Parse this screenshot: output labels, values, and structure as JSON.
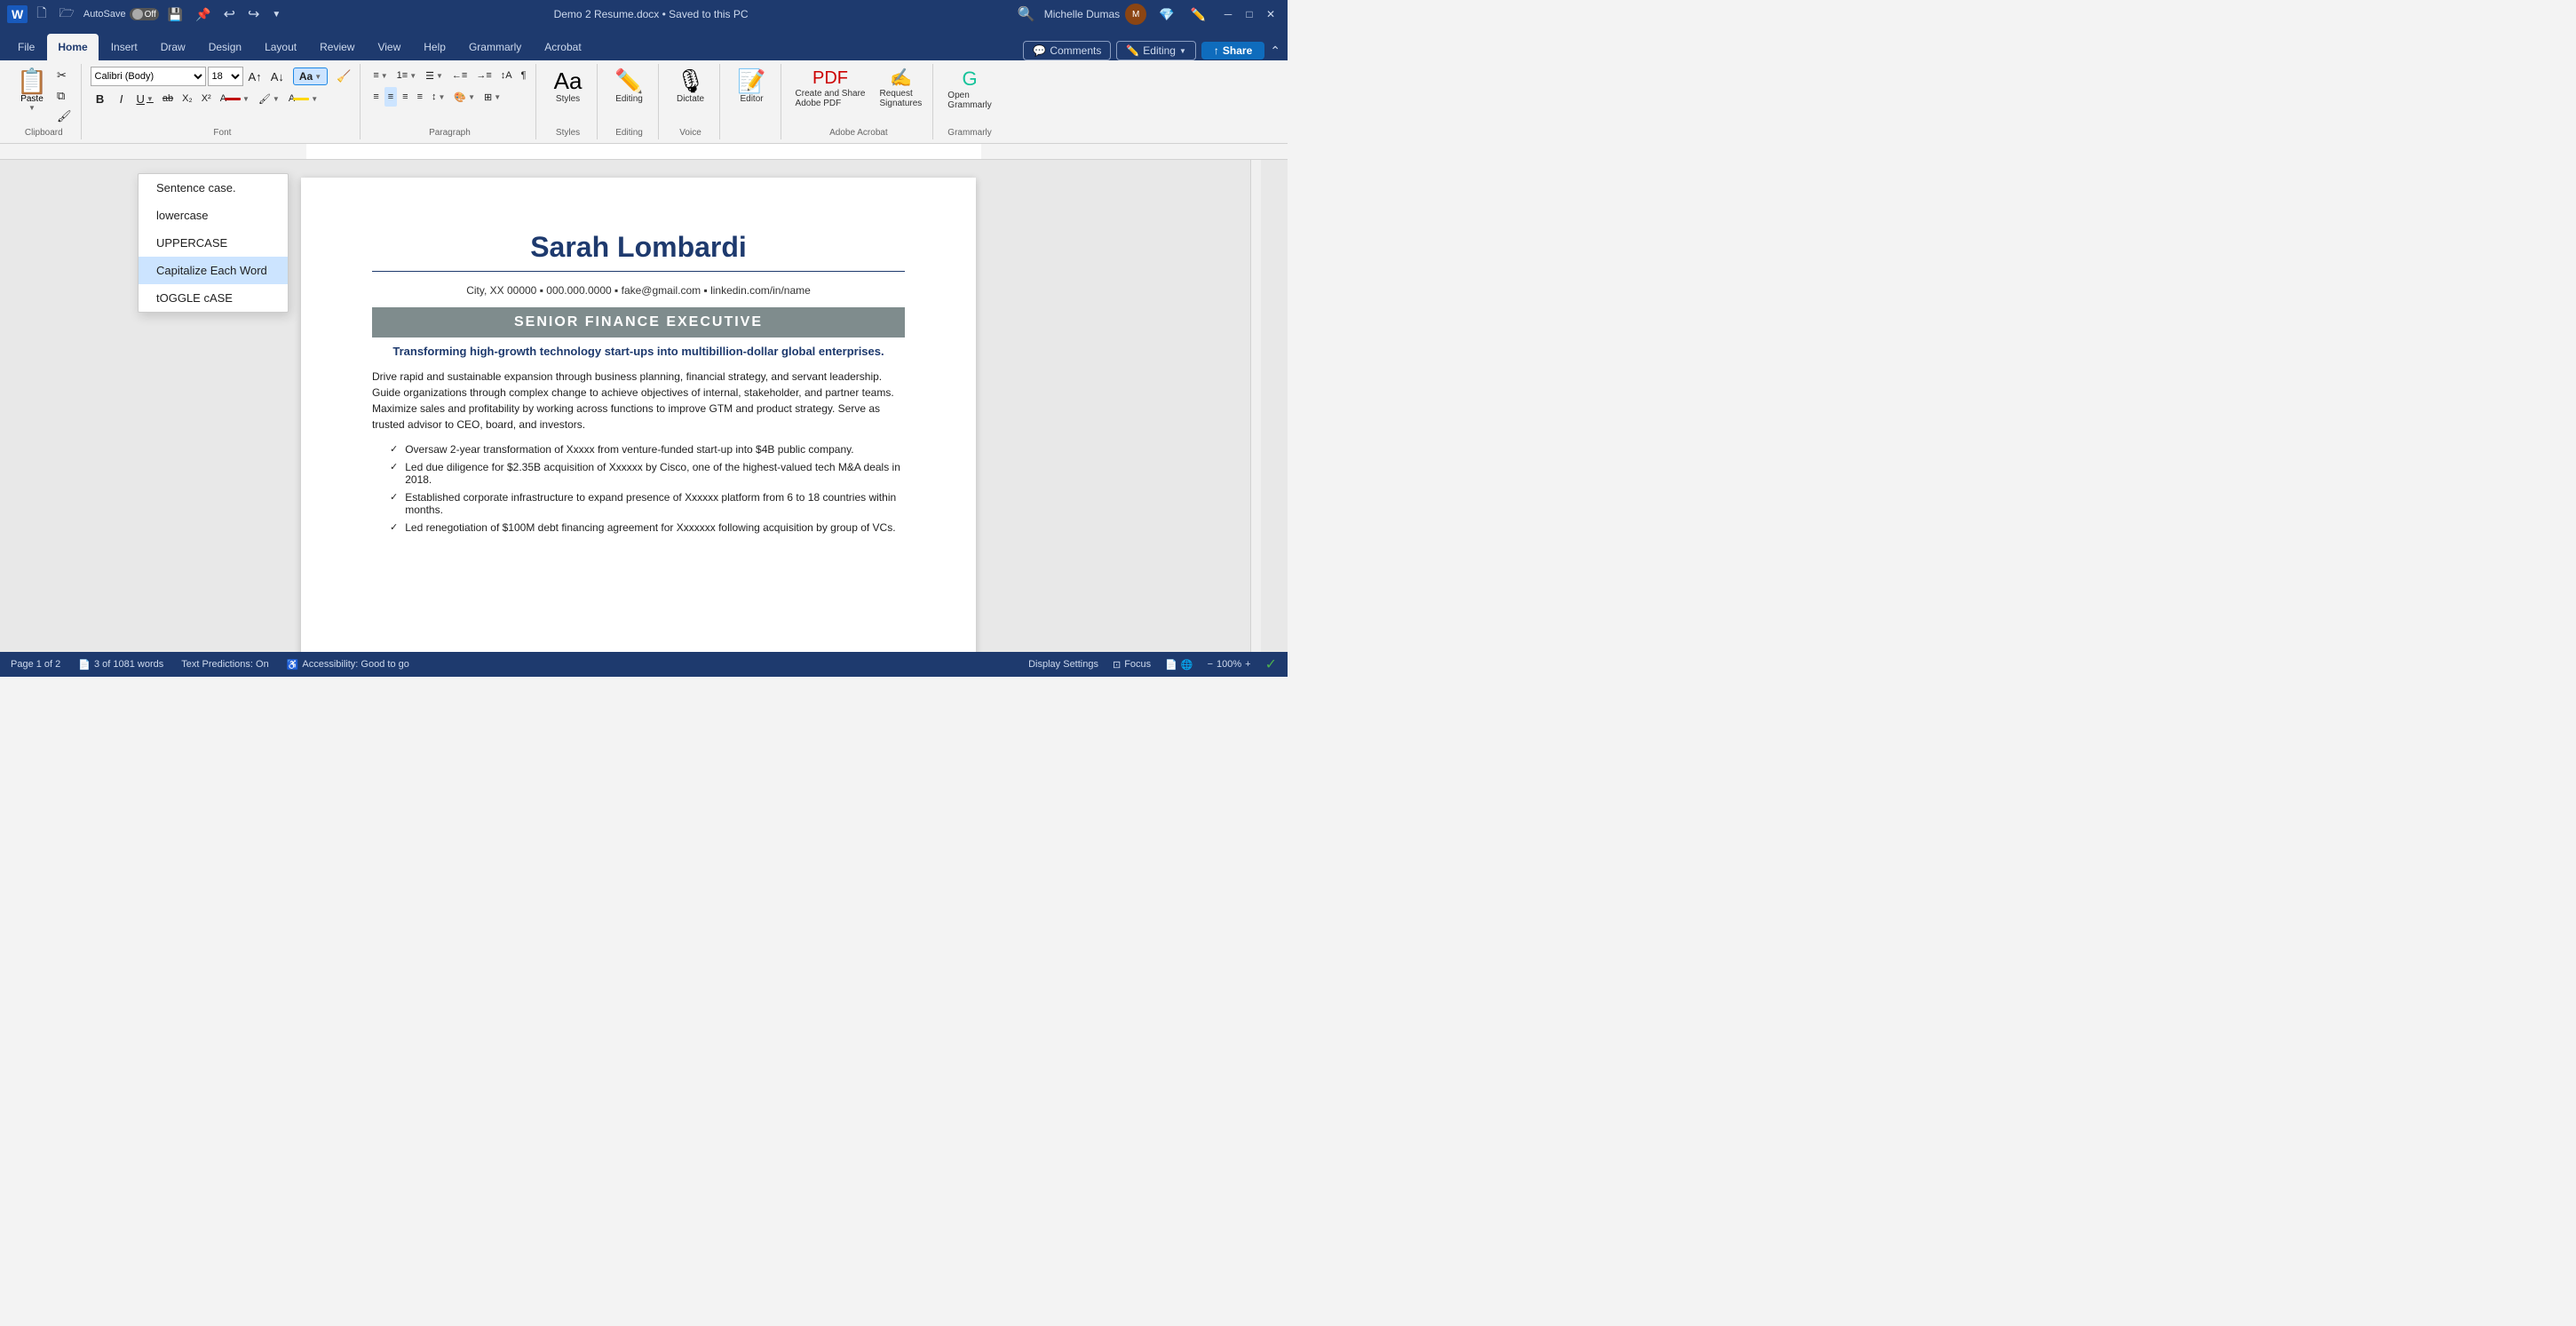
{
  "titlebar": {
    "word_icon": "W",
    "autosave_label": "AutoSave",
    "autosave_state": "Off",
    "title": "Demo 2 Resume.docx • Saved to this PC",
    "user_name": "Michelle Dumas",
    "undo_icon": "↩",
    "redo_icon": "↪",
    "save_icon": "💾",
    "pin_icon": "📌",
    "minimize": "─",
    "maximize": "□",
    "close": "✕"
  },
  "ribbon_tabs": {
    "tabs": [
      "File",
      "Home",
      "Insert",
      "Draw",
      "Design",
      "Layout",
      "Review",
      "View",
      "Help",
      "Grammarly",
      "Acrobat"
    ],
    "active": "Home",
    "comments_label": "Comments",
    "editing_label": "Editing",
    "share_label": "Share"
  },
  "ribbon": {
    "clipboard_label": "Clipboard",
    "font_label": "Font",
    "paragraph_label": "Paragraph",
    "styles_label": "Styles",
    "font_name": "Calibri (Body)",
    "font_size": "18",
    "bold": "B",
    "italic": "I",
    "underline": "U",
    "strikethrough": "ab",
    "subscript": "X₂",
    "superscript": "X²",
    "font_color": "A",
    "highlight": "🖌",
    "change_case_label": "Aa",
    "grow_font": "A↑",
    "shrink_font": "A↓",
    "paste_label": "Paste",
    "styles_btn": "Styles",
    "editing_btn": "Editing",
    "voice_label": "Voice",
    "adobe_label": "Adobe Acrobat",
    "grammarly_label": "Grammarly",
    "dictate_label": "Dictate",
    "editor_label": "Editor",
    "create_share_pdf_label": "Create and Share\nAdobe PDF",
    "request_signatures_label": "Request\nSignatures",
    "open_grammarly_label": "Open\nGrammarly"
  },
  "change_case_menu": {
    "items": [
      {
        "id": "sentence-case",
        "label": "Sentence case."
      },
      {
        "id": "lowercase",
        "label": "lowercase"
      },
      {
        "id": "uppercase",
        "label": "UPPERCASE"
      },
      {
        "id": "capitalize-each-word",
        "label": "Capitalize Each Word"
      },
      {
        "id": "toggle-case",
        "label": "tOGGLE cASE"
      }
    ],
    "highlighted": "capitalize-each-word"
  },
  "resume": {
    "name": "Sarah Lombardi",
    "contact": "City, XX 00000 ▪ 000.000.0000 ▪ fake@gmail.com ▪ linkedin.com/in/name",
    "title": "SENIOR FINANCE EXECUTIVE",
    "subtitle": "Transforming high-growth technology start-ups into multibillion-dollar global enterprises.",
    "body": "Drive rapid and sustainable expansion through business planning, financial strategy, and servant leadership. Guide organizations through complex change to achieve objectives of internal, stakeholder, and partner teams. Maximize sales and profitability by working across functions to improve GTM and product strategy. Serve as trusted advisor to CEO, board, and investors.",
    "bullets": [
      "Oversaw 2-year transformation of Xxxxx from venture-funded start-up into $4B public company.",
      "Led due diligence for $2.35B acquisition of Xxxxxx by Cisco, one of the highest-valued tech M&A deals in 2018.",
      "Established corporate infrastructure to expand presence of Xxxxxx platform from 6 to 18 countries within months.",
      "Led renegotiation of $100M debt financing agreement for Xxxxxxx following acquisition by group of VCs."
    ]
  },
  "statusbar": {
    "page_label": "Page 1 of 2",
    "words_label": "3 of 1081 words",
    "text_predictions": "Text Predictions: On",
    "accessibility": "Accessibility: Good to go",
    "display_settings": "Display Settings",
    "focus": "Focus"
  }
}
